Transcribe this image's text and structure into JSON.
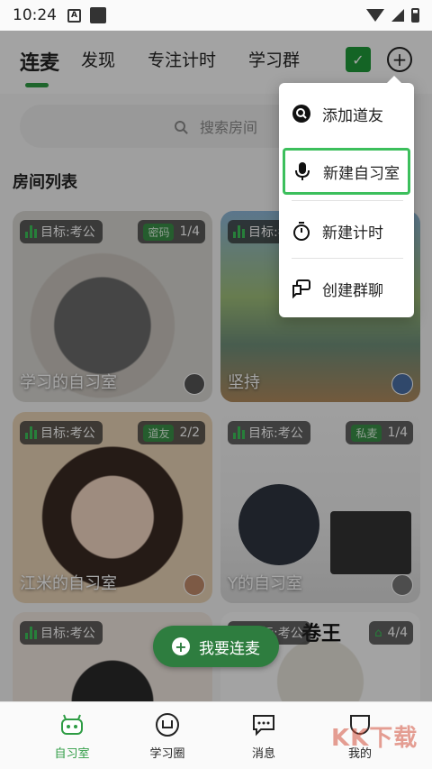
{
  "status": {
    "time": "10:24",
    "notif_letter": "A"
  },
  "nav": {
    "tabs": [
      "连麦",
      "发现",
      "专注计时",
      "学习群"
    ],
    "active_tab": "连麦"
  },
  "search": {
    "placeholder": "搜索房间"
  },
  "section": {
    "title": "房间列表"
  },
  "rooms": [
    {
      "goal": "目标:考公",
      "tag": "密码",
      "count": "1/4",
      "title": "学习的自习室"
    },
    {
      "goal": "目标:考公",
      "tag": "",
      "count": "",
      "title": "坚持"
    },
    {
      "goal": "目标:考公",
      "tag": "道友",
      "count": "2/2",
      "title": "江米的自习室"
    },
    {
      "goal": "目标:考公",
      "tag": "私麦",
      "count": "1/4",
      "title": "Y的自习室"
    },
    {
      "goal": "目标:考公",
      "tag": "",
      "count": "",
      "title": ""
    },
    {
      "goal": "目标:考公",
      "tag": "",
      "count": "4/4",
      "title": "",
      "overlay_text": "卷王"
    }
  ],
  "menu": {
    "items": [
      {
        "label": "添加道友",
        "icon": "search-icon"
      },
      {
        "label": "新建自习室",
        "icon": "microphone-icon"
      },
      {
        "label": "新建计时",
        "icon": "stopwatch-icon"
      },
      {
        "label": "创建群聊",
        "icon": "chat-icon"
      }
    ],
    "highlight_color": "#3cbf5c"
  },
  "fab": {
    "label": "我要连麦"
  },
  "bottom_nav": {
    "items": [
      {
        "label": "自习室",
        "icon": "study-room-icon",
        "active": true
      },
      {
        "label": "学习圈",
        "icon": "circle-icon",
        "active": false
      },
      {
        "label": "消息",
        "icon": "message-icon",
        "active": false
      },
      {
        "label": "我的",
        "icon": "profile-icon",
        "active": false
      }
    ]
  },
  "watermark": "KK下载",
  "colors": {
    "brand_green": "#2e9c44",
    "fab_green": "#2e7d3f"
  }
}
